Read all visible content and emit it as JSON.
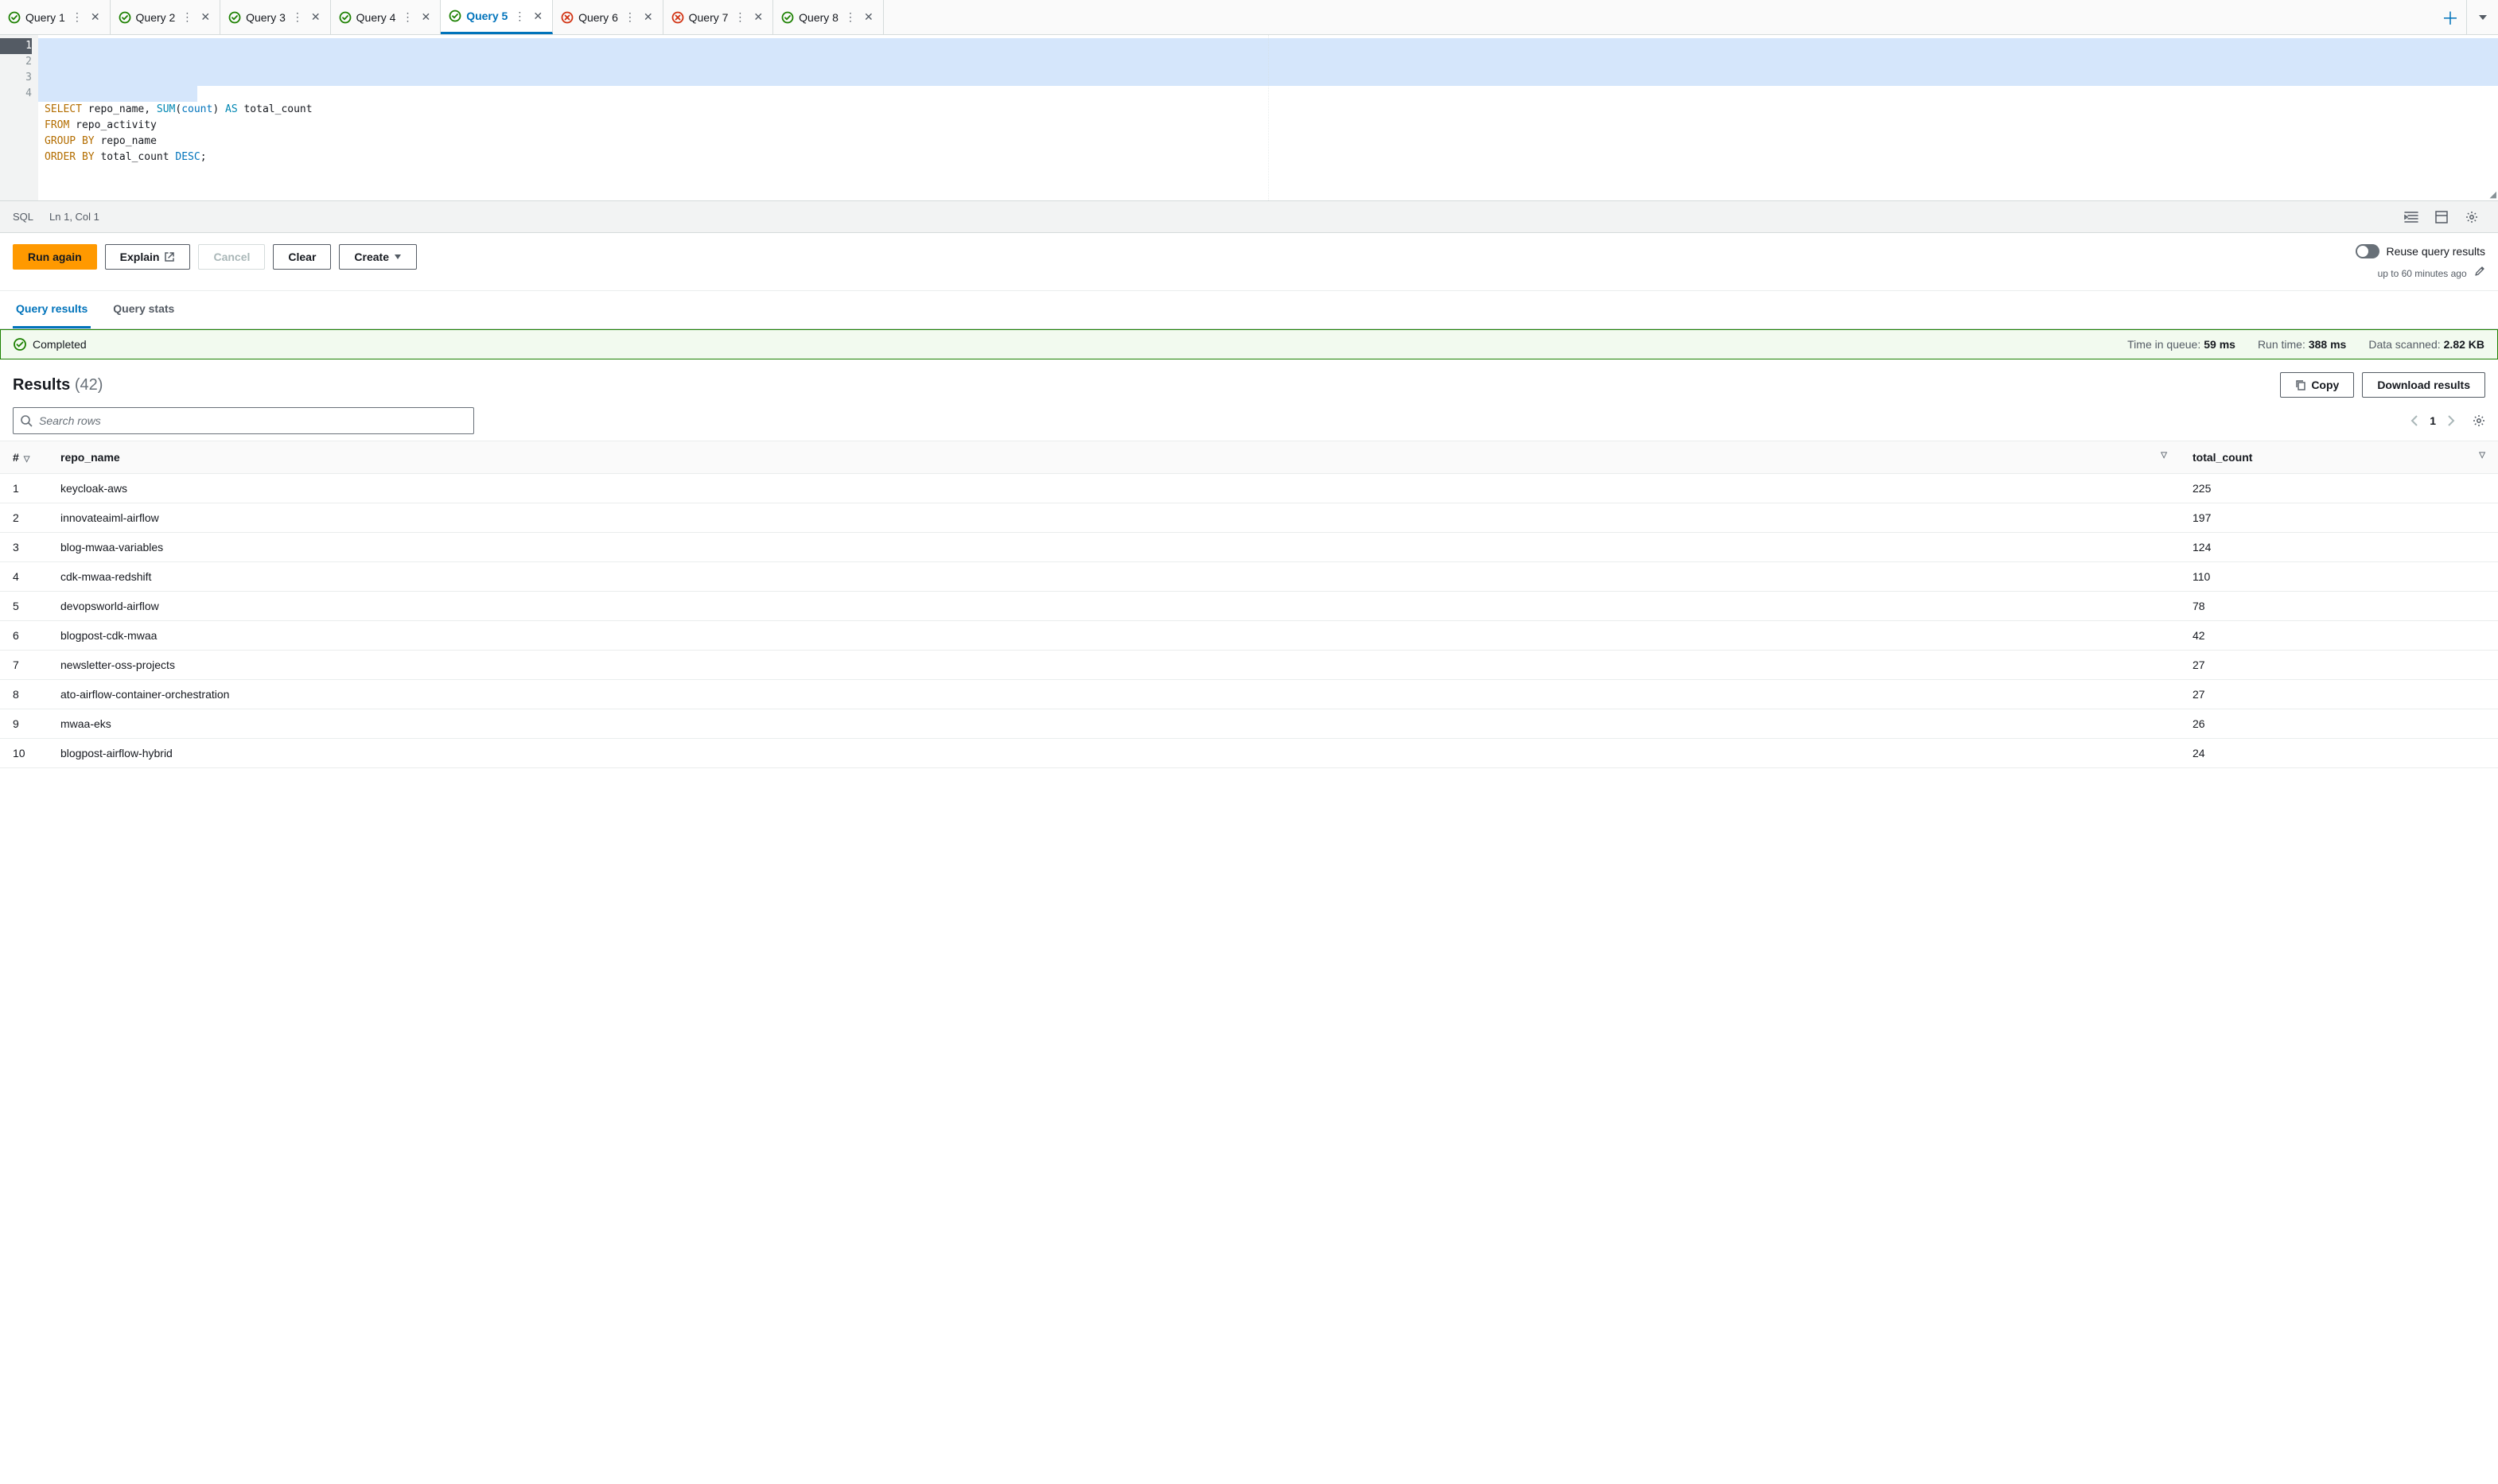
{
  "tabs": [
    {
      "label": "Query 1",
      "status": "ok",
      "active": false
    },
    {
      "label": "Query 2",
      "status": "ok",
      "active": false
    },
    {
      "label": "Query 3",
      "status": "ok",
      "active": false
    },
    {
      "label": "Query 4",
      "status": "ok",
      "active": false
    },
    {
      "label": "Query 5",
      "status": "ok",
      "active": true
    },
    {
      "label": "Query 6",
      "status": "err",
      "active": false
    },
    {
      "label": "Query 7",
      "status": "err",
      "active": false
    },
    {
      "label": "Query 8",
      "status": "ok",
      "active": false
    }
  ],
  "editor": {
    "lines": [
      "1",
      "2",
      "3",
      "4"
    ],
    "sql_tokens": [
      [
        {
          "t": "SELECT",
          "c": "kw"
        },
        {
          "t": " repo_name, ",
          "c": ""
        },
        {
          "t": "SUM",
          "c": "kw2"
        },
        {
          "t": "(",
          "c": ""
        },
        {
          "t": "count",
          "c": "id-blue"
        },
        {
          "t": ") ",
          "c": ""
        },
        {
          "t": "AS",
          "c": "kw2"
        },
        {
          "t": " total_count",
          "c": ""
        }
      ],
      [
        {
          "t": "FROM",
          "c": "kw"
        },
        {
          "t": " repo_activity",
          "c": ""
        }
      ],
      [
        {
          "t": "GROUP BY",
          "c": "kw"
        },
        {
          "t": " repo_name",
          "c": ""
        }
      ],
      [
        {
          "t": "ORDER BY",
          "c": "kw"
        },
        {
          "t": " total_count ",
          "c": ""
        },
        {
          "t": "DESC",
          "c": "id-blue"
        },
        {
          "t": ";",
          "c": ""
        }
      ]
    ],
    "status": {
      "lang": "SQL",
      "pos": "Ln 1, Col 1"
    }
  },
  "actions": {
    "run": "Run again",
    "explain": "Explain",
    "cancel": "Cancel",
    "clear": "Clear",
    "create": "Create",
    "reuse_label": "Reuse query results",
    "reuse_sub": "up to 60 minutes ago"
  },
  "subtabs": {
    "results": "Query results",
    "stats": "Query stats"
  },
  "banner": {
    "status": "Completed",
    "queue_lbl": "Time in queue:",
    "queue_val": "59 ms",
    "runtime_lbl": "Run time:",
    "runtime_val": "388 ms",
    "scanned_lbl": "Data scanned:",
    "scanned_val": "2.82 KB"
  },
  "results": {
    "title": "Results",
    "count": "(42)",
    "copy": "Copy",
    "download": "Download results",
    "search_placeholder": "Search rows",
    "page": "1",
    "columns": {
      "idx": "#",
      "name": "repo_name",
      "total": "total_count"
    },
    "rows": [
      {
        "i": "1",
        "name": "keycloak-aws",
        "total": "225"
      },
      {
        "i": "2",
        "name": "innovateaiml-airflow",
        "total": "197"
      },
      {
        "i": "3",
        "name": "blog-mwaa-variables",
        "total": "124"
      },
      {
        "i": "4",
        "name": "cdk-mwaa-redshift",
        "total": "110"
      },
      {
        "i": "5",
        "name": "devopsworld-airflow",
        "total": "78"
      },
      {
        "i": "6",
        "name": "blogpost-cdk-mwaa",
        "total": "42"
      },
      {
        "i": "7",
        "name": "newsletter-oss-projects",
        "total": "27"
      },
      {
        "i": "8",
        "name": "ato-airflow-container-orchestration",
        "total": "27"
      },
      {
        "i": "9",
        "name": "mwaa-eks",
        "total": "26"
      },
      {
        "i": "10",
        "name": "blogpost-airflow-hybrid",
        "total": "24"
      }
    ]
  }
}
